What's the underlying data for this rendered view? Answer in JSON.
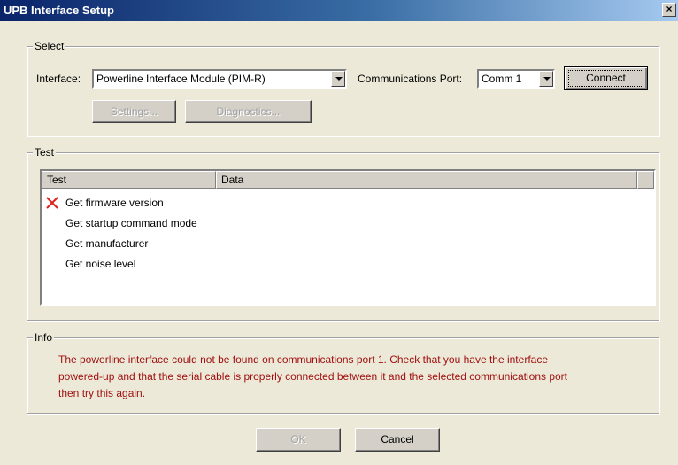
{
  "window": {
    "title": "UPB Interface Setup",
    "close_glyph": "×"
  },
  "select_group": {
    "legend": "Select",
    "interface_label": "Interface:",
    "interface_value": "Powerline Interface Module (PIM-R)",
    "port_label": "Communications Port:",
    "port_value": "Comm 1",
    "connect_label": "Connect",
    "settings_label": "Settings...",
    "diagnostics_label": "Diagnostics..."
  },
  "test_group": {
    "legend": "Test",
    "columns": [
      "Test",
      "Data"
    ],
    "rows": [
      {
        "label": "Get firmware version",
        "status": "failed"
      },
      {
        "label": "Get startup command mode",
        "status": ""
      },
      {
        "label": "Get manufacturer",
        "status": ""
      },
      {
        "label": "Get noise level",
        "status": ""
      }
    ]
  },
  "info_group": {
    "legend": "Info",
    "lines": [
      "The powerline interface could not be found on communications port 1.  Check that you have the interface",
      "powered-up and that the serial cable is properly connected between it and the selected communications port",
      "then try this again."
    ],
    "text_color": "#a01010"
  },
  "footer": {
    "ok_label": "OK",
    "cancel_label": "Cancel"
  },
  "icons": {
    "error": "red-x-icon",
    "dropdown": "chevron-down-icon",
    "close": "close-icon"
  }
}
